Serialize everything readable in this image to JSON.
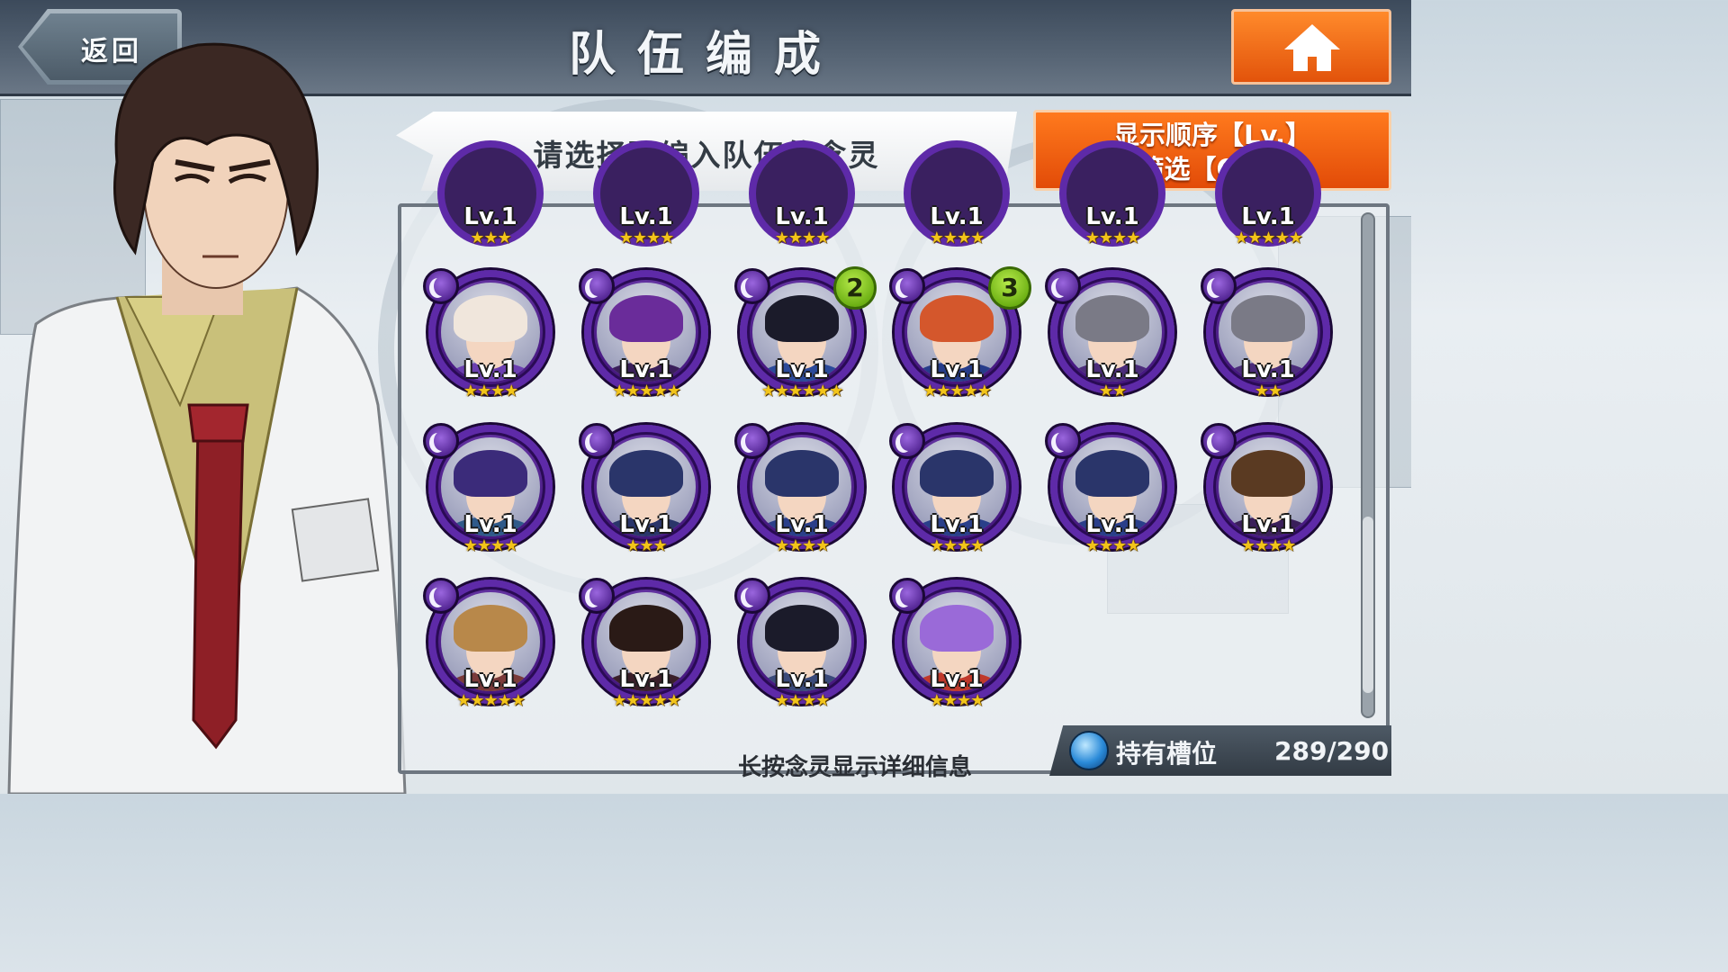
{
  "header": {
    "title": "队伍编成",
    "back_label": "返回"
  },
  "banner": {
    "text": "请选择要编入队伍的念灵"
  },
  "sort": {
    "line1": "显示顺序【Lv.】",
    "line2": "筛选【ON】"
  },
  "top_row": [
    {
      "level": "Lv.1",
      "stars": "★★★"
    },
    {
      "level": "Lv.1",
      "stars": "★★★★"
    },
    {
      "level": "Lv.1",
      "stars": "★★★★"
    },
    {
      "level": "Lv.1",
      "stars": "★★★★"
    },
    {
      "level": "Lv.1",
      "stars": "★★★★"
    },
    {
      "level": "Lv.1",
      "stars": "★★★★★"
    }
  ],
  "units": [
    {
      "level": "Lv.1",
      "stars": "★★★★",
      "badge": "",
      "hair": "#f0e6dc",
      "shirt": "#6b3fb0"
    },
    {
      "level": "Lv.1",
      "stars": "★★★★★",
      "badge": "",
      "hair": "#6a2c9a",
      "shirt": "#3a1f5a"
    },
    {
      "level": "Lv.1",
      "stars": "★★★★★★",
      "badge": "2",
      "hair": "#1b1b2a",
      "shirt": "#2b4a9a"
    },
    {
      "level": "Lv.1",
      "stars": "★★★★★",
      "badge": "3",
      "hair": "#d4572c",
      "shirt": "#263c8a"
    },
    {
      "level": "Lv.1",
      "stars": "★★",
      "badge": "",
      "hair": "#7a7a86",
      "shirt": "#4b2c7a"
    },
    {
      "level": "Lv.1",
      "stars": "★★",
      "badge": "",
      "hair": "#7a7a86",
      "shirt": "#4b2c7a"
    },
    {
      "level": "Lv.1",
      "stars": "★★★★",
      "badge": "",
      "hair": "#3b2b7a",
      "shirt": "#2f5a8a"
    },
    {
      "level": "Lv.1",
      "stars": "★★★",
      "badge": "",
      "hair": "#2a356a",
      "shirt": "#2a356a"
    },
    {
      "level": "Lv.1",
      "stars": "★★★★",
      "badge": "",
      "hair": "#2a356a",
      "shirt": "#2a3f8a"
    },
    {
      "level": "Lv.1",
      "stars": "★★★★",
      "badge": "",
      "hair": "#2a356a",
      "shirt": "#2a3f8a"
    },
    {
      "level": "Lv.1",
      "stars": "★★★★",
      "badge": "",
      "hair": "#2a356a",
      "shirt": "#2a3f8a"
    },
    {
      "level": "Lv.1",
      "stars": "★★★★",
      "badge": "",
      "hair": "#5a3a22",
      "shirt": "#3a1f5a"
    },
    {
      "level": "Lv.1",
      "stars": "★★★★★",
      "badge": "",
      "hair": "#b8884a",
      "shirt": "#7a3a3a"
    },
    {
      "level": "Lv.1",
      "stars": "★★★★★",
      "badge": "",
      "hair": "#2a1a16",
      "shirt": "#3a1f2a"
    },
    {
      "level": "Lv.1",
      "stars": "★★★★",
      "badge": "",
      "hair": "#1b1b2a",
      "shirt": "#3a4a7a"
    },
    {
      "level": "Lv.1",
      "stars": "★★★★",
      "badge": "",
      "hair": "#9a6ad8",
      "shirt": "#c0392b"
    }
  ],
  "footer": {
    "hint": "长按念灵显示详细信息",
    "slot_label": "持有槽位",
    "slot_count": "289/290"
  }
}
